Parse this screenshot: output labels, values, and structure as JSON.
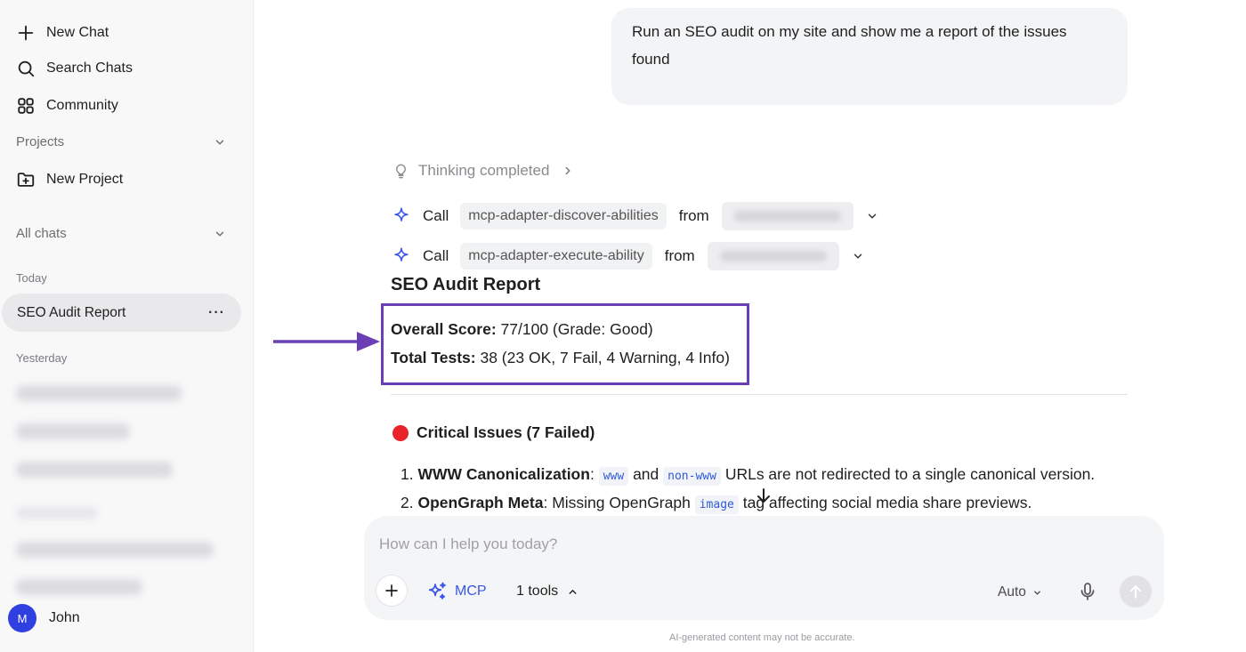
{
  "sidebar": {
    "new_chat": "New Chat",
    "search_chats": "Search Chats",
    "community": "Community",
    "projects": "Projects",
    "new_project": "New Project",
    "all_chats": "All chats",
    "today_label": "Today",
    "active_chat": "SEO Audit Report",
    "more_menu": "···",
    "yesterday_label": "Yesterday",
    "user": {
      "initial": "M",
      "name": "John"
    }
  },
  "conversation": {
    "user_message": "Run an SEO audit on my site and show me a report of the issues found",
    "thinking": "Thinking completed",
    "calls": [
      {
        "verb": "Call",
        "tool": "mcp-adapter-discover-abilities",
        "from": "from"
      },
      {
        "verb": "Call",
        "tool": "mcp-adapter-execute-ability",
        "from": "from"
      }
    ],
    "report": {
      "title": "SEO Audit Report",
      "score_label": "Overall Score:",
      "score_value": "77/100 (Grade: Good)",
      "tests_label": "Total Tests:",
      "tests_value": "38 (23 OK, 7 Fail, 4 Warning, 4 Info)",
      "critical_heading": "Critical Issues (7 Failed)",
      "issues": [
        {
          "num": "1.",
          "title": "WWW Canonicalization",
          "sep": ":",
          "code1": "www",
          "mid": "and",
          "code2": "non-www",
          "rest": "URLs are not redirected to a single canonical version."
        },
        {
          "num": "2.",
          "title": "OpenGraph Meta",
          "pre": ": Missing OpenGraph",
          "code": "image",
          "rest": "tag affecting social media share previews."
        }
      ]
    }
  },
  "composer": {
    "placeholder": "How can I help you today?",
    "mcp_label": "MCP",
    "tools_label": "1 tools",
    "model_label": "Auto",
    "disclaimer": "AI-generated content may not be accurate."
  },
  "colors": {
    "highlight_border": "#6a3fb5",
    "accent_blue": "#3a56e6",
    "critical_red": "#e8232a",
    "avatar_bg": "#2f3fe0"
  },
  "icons": [
    "plus-icon",
    "search-icon",
    "community-grid-icon",
    "chevron-down-icon",
    "folder-plus-icon",
    "lightbulb-icon",
    "chevron-right-icon",
    "sparkle-icon",
    "arrow-down-icon",
    "mic-icon",
    "arrow-up-icon",
    "chevron-up-icon"
  ]
}
